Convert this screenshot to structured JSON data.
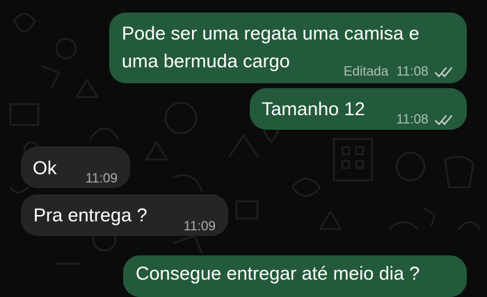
{
  "colors": {
    "outgoing_bubble": "#235a3b",
    "incoming_bubble": "#252525",
    "background": "#0b0b0b",
    "read_ticks": "#c9d4cc"
  },
  "messages": [
    {
      "direction": "outgoing",
      "lines": [
        "Pode ser uma regata uma camisa e",
        "uma bermuda cargo"
      ],
      "edited_label": "Editada",
      "time": "11:08",
      "status_icon": "double-check-icon"
    },
    {
      "direction": "outgoing",
      "lines": [
        "Tamanho 12"
      ],
      "time": "11:08",
      "status_icon": "double-check-icon"
    },
    {
      "direction": "incoming",
      "lines": [
        "Ok"
      ],
      "time": "11:09"
    },
    {
      "direction": "incoming",
      "lines": [
        "Pra entrega ?"
      ],
      "time": "11:09"
    },
    {
      "direction": "outgoing",
      "lines": [
        "Consegue entregar até meio dia ?"
      ]
    }
  ]
}
